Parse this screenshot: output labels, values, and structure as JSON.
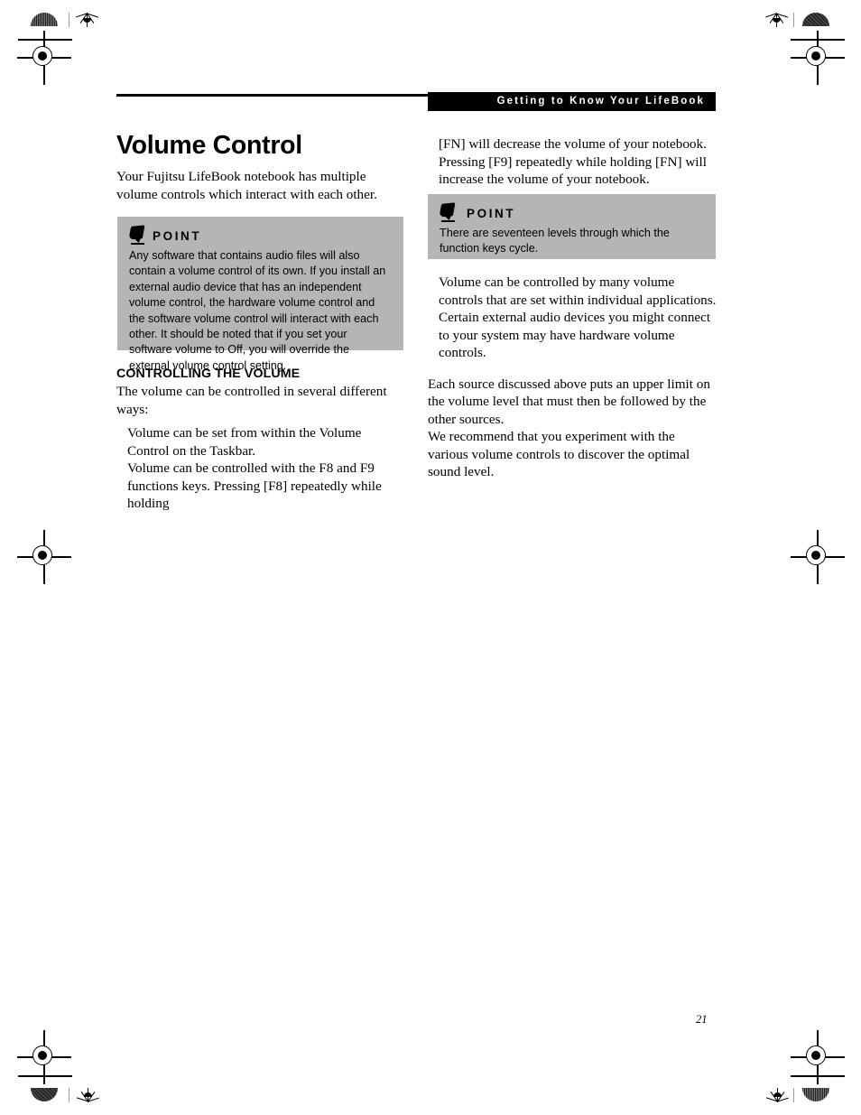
{
  "header": {
    "section_title": "Getting to Know Your LifeBook"
  },
  "page": {
    "number": "21"
  },
  "left_column": {
    "title": "Volume Control",
    "intro": "Your Fujitsu LifeBook notebook has multiple volume controls which interact with each other.",
    "point_box": {
      "label": "POINT",
      "icon": "pointing-pen-icon",
      "text": "Any software that contains audio files will also contain a volume control of its own. If you install an external audio device that has an independent volume control, the hardware volume control and the software volume control will interact with each other. It should be noted that if you set your software volume to Off, you will override the external volume control setting."
    },
    "subhead": "CONTROLLING THE VOLUME",
    "lead": "The volume can be controlled in several different ways:",
    "bullets": [
      "Volume can be set from within the Volume Control on the Taskbar.",
      "Volume can be controlled with the F8 and F9 functions keys. Pressing [F8] repeatedly while holding"
    ]
  },
  "right_column": {
    "continuation": "[FN] will decrease the volume of your notebook. Pressing [F9] repeatedly while holding [FN] will increase the volume of your notebook.",
    "point_box": {
      "label": "POINT",
      "icon": "pointing-pen-icon",
      "text": "There are seventeen levels through which the function keys cycle."
    },
    "bullets": [
      "Volume can be controlled by many volume controls that are set within individual applications.",
      "Certain external audio devices you might connect to your system may have hardware volume controls."
    ],
    "paragraphs": [
      "Each source discussed above puts an upper limit on the volume level that must then be followed by the other sources.",
      "We recommend that you experiment with the various volume controls to discover the optimal sound level."
    ]
  },
  "colors": {
    "callout_background": "#b5b5b5",
    "header_bar": "#000000",
    "text": "#000000",
    "page_background": "#ffffff"
  }
}
